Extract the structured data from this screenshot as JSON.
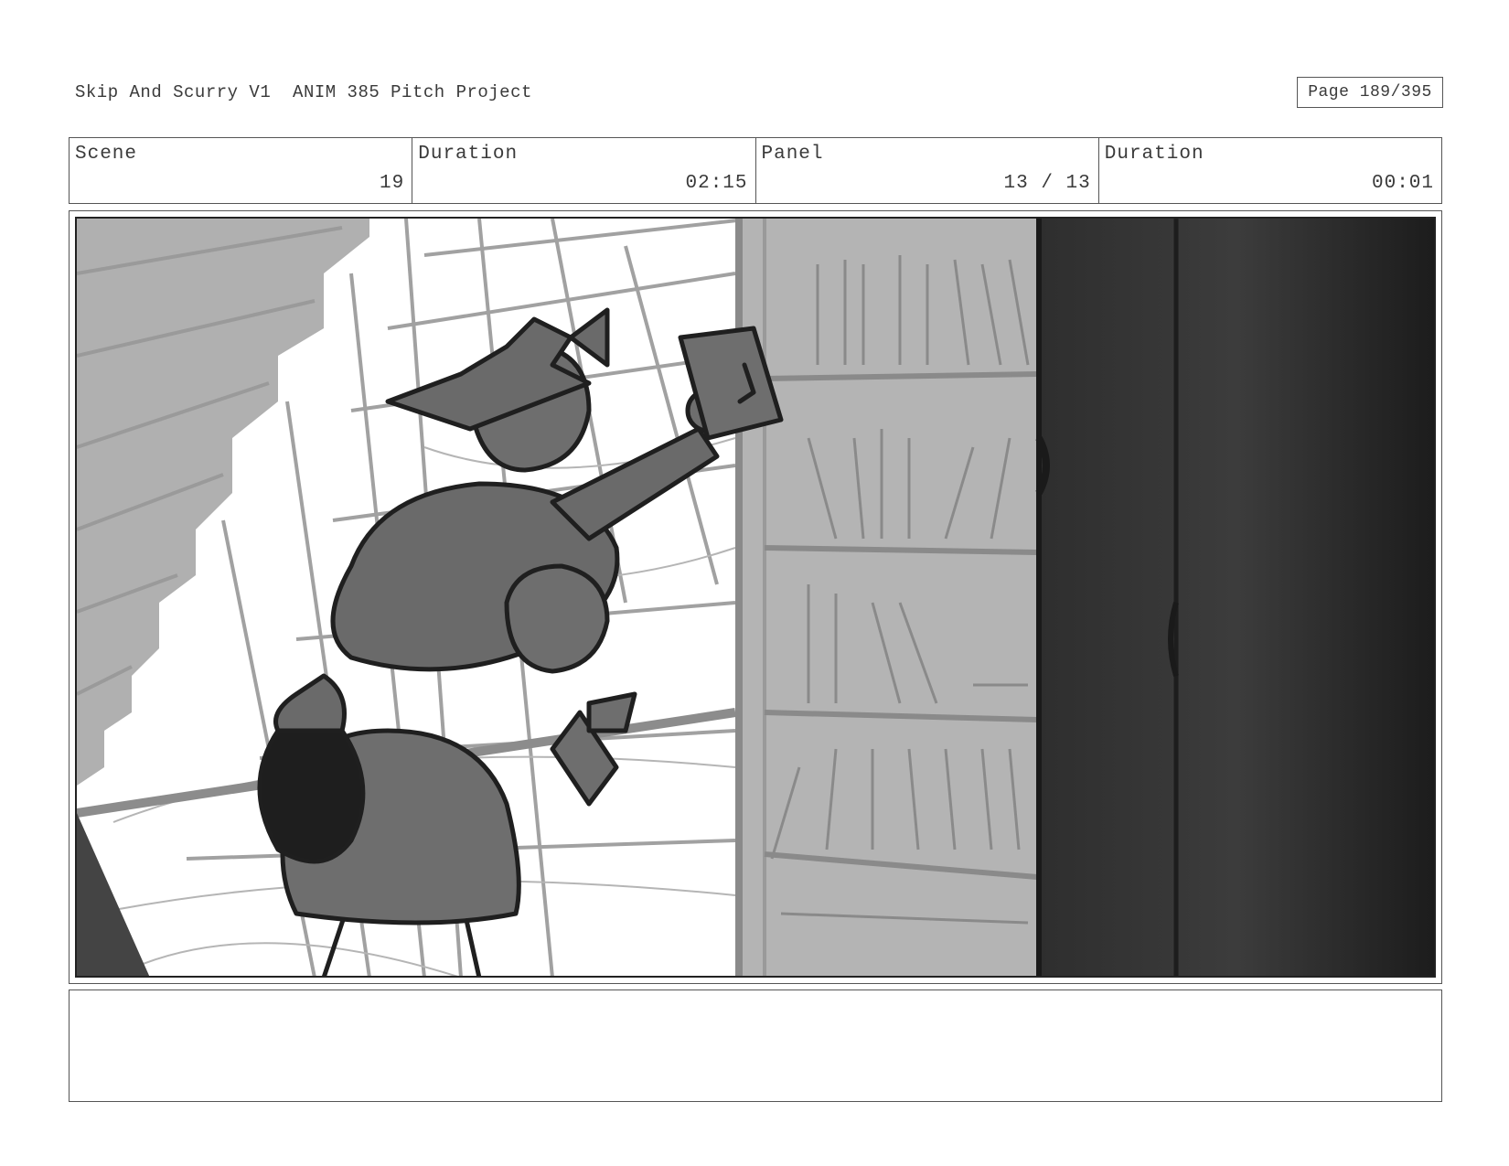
{
  "header": {
    "project_title": "Skip And Scurry V1  ANIM 385 Pitch Project",
    "page_indicator": "Page 189/395"
  },
  "info": {
    "scene_label": "Scene",
    "scene_value": "19",
    "scene_duration_label": "Duration",
    "scene_duration_value": "02:15",
    "panel_label": "Panel",
    "panel_value": "13 / 13",
    "panel_duration_label": "Duration",
    "panel_duration_value": "00:01"
  },
  "notes": {
    "text": ""
  }
}
